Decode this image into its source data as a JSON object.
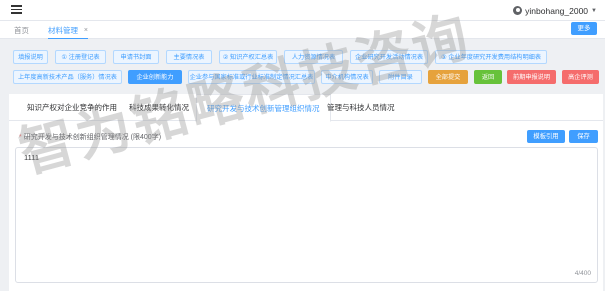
{
  "header": {
    "menu_icon": "hamburger-icon",
    "user_name": "yinbohang_2000",
    "user_icon": "user-avatar-icon",
    "caret_icon": "caret-down-icon"
  },
  "tabs": {
    "home": "首页",
    "active": "材料管理",
    "close": "×",
    "more": "更多"
  },
  "buttons": [
    {
      "label": "填报说明",
      "style": "plain"
    },
    {
      "label": "① 注册登记表",
      "style": "plain"
    },
    {
      "label": "申请书封面",
      "style": "plain"
    },
    {
      "label": "主要情况表",
      "style": "plain"
    },
    {
      "label": "② 知识产权汇总表",
      "style": "plain"
    },
    {
      "label": "人力资源情况表",
      "style": "plain"
    },
    {
      "label": "企业研究开发活动情况表",
      "style": "plain"
    },
    {
      "label": "③ 企业年度研究开发费用结构明细表",
      "style": "plain"
    },
    {
      "label": "上年度高新技术产品（服务）情况表",
      "style": "plain"
    },
    {
      "label": "企业创新能力",
      "style": "primary"
    },
    {
      "label": "企业参与国家标准或行业标准制定情况汇总表",
      "style": "plain"
    },
    {
      "label": "中介机构情况表",
      "style": "plain"
    },
    {
      "label": "附件目录",
      "style": "plain"
    },
    {
      "label": "全部提交",
      "style": "warning"
    },
    {
      "label": "返回",
      "style": "success"
    },
    {
      "label": "前期申报说明",
      "style": "danger"
    },
    {
      "label": "高企评测",
      "style": "danger"
    }
  ],
  "subtabs": [
    "知识产权对企业竞争的作用",
    "科技成果转化情况",
    "研究开发与技术创新管理组织情况",
    "管理与科技人员情况"
  ],
  "active_subtab": 2,
  "form": {
    "required_mark": "*",
    "label": "研究开发与技术创新组织管理情况 (限400字)",
    "template_button": "模板引用",
    "save_button": "保存",
    "value": "1111",
    "counter": "4/400"
  },
  "watermark": "智为铭略科技咨询",
  "colors": {
    "accent": "#409eff",
    "warning": "#e6a23c",
    "success": "#67c23a",
    "danger": "#f56c6c"
  }
}
